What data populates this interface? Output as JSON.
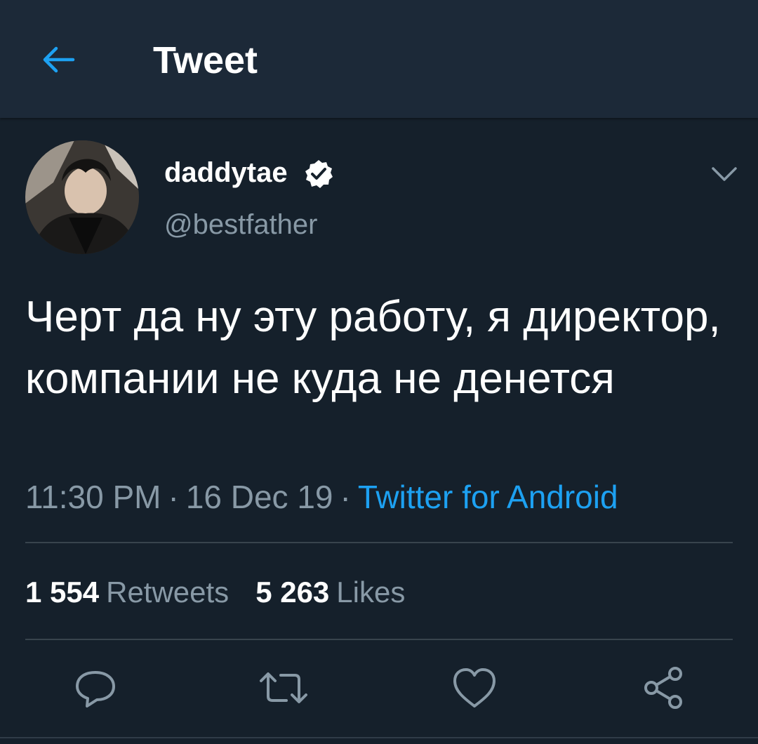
{
  "header": {
    "title": "Tweet",
    "back_icon": "arrow-left-icon"
  },
  "tweet": {
    "display_name": "daddytae",
    "verified": true,
    "handle": "@bestfather",
    "text": "Черт да ну эту работу, я директор, компании не куда не денется",
    "time": "11:30 PM",
    "date": "16 Dec 19",
    "separator": "·",
    "source": "Twitter for Android",
    "caret_icon": "chevron-down-icon"
  },
  "stats": {
    "retweets_count": "1 554",
    "retweets_label": "Retweets",
    "likes_count": "5 263",
    "likes_label": "Likes"
  },
  "actions": [
    "reply-icon",
    "retweet-icon",
    "like-icon",
    "share-icon"
  ],
  "colors": {
    "background": "#15202b",
    "header_background": "#1c2938",
    "accent": "#1da1f2",
    "secondary_text": "#8899a6",
    "divider": "#38444d"
  }
}
